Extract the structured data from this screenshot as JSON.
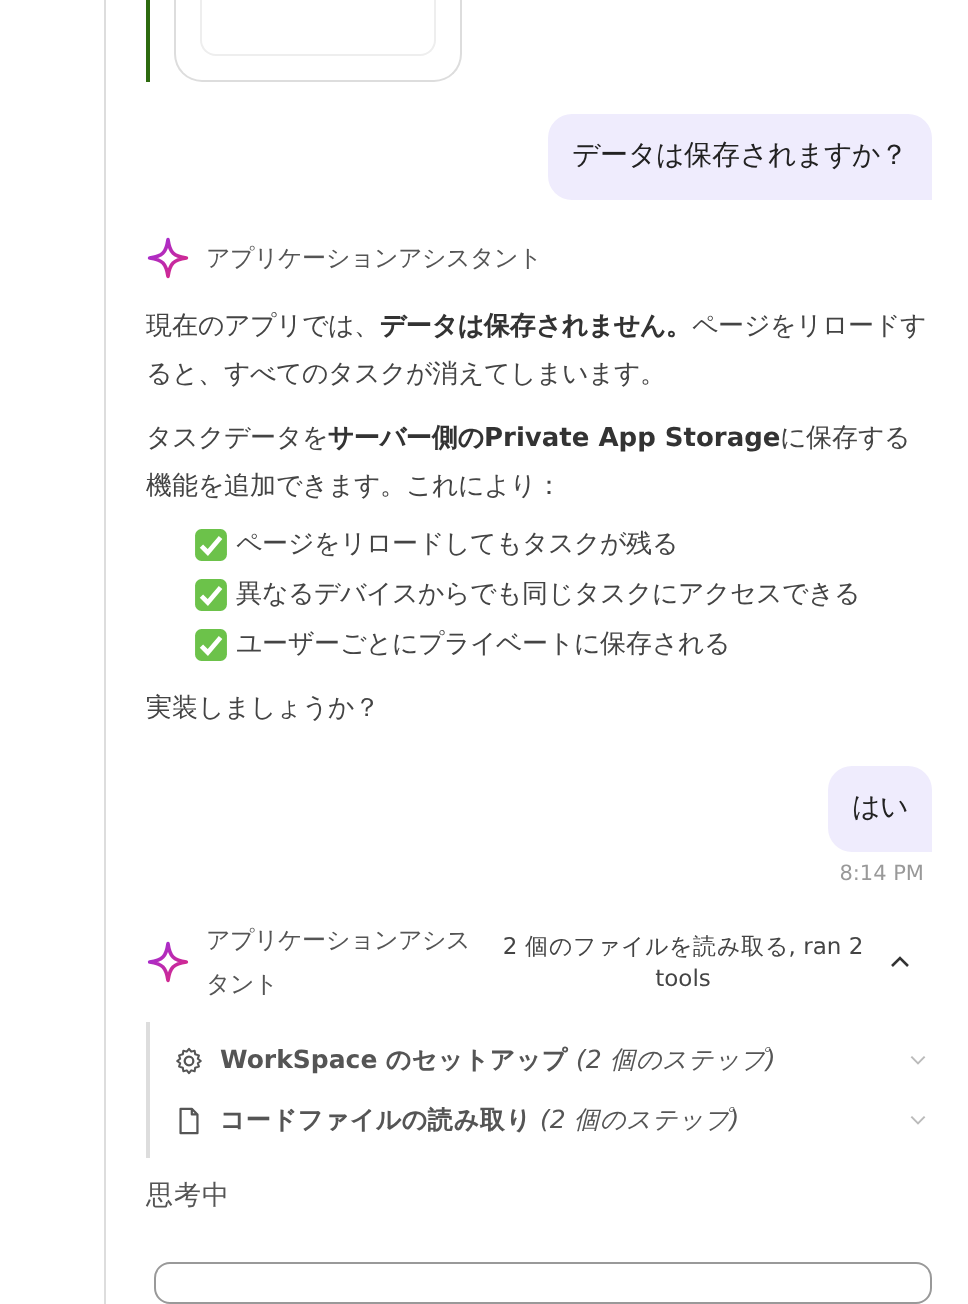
{
  "thread": [
    {
      "kind": "user",
      "text": "データは保存されますか？"
    },
    {
      "kind": "assistant",
      "sender": "アプリケーションアシスタント",
      "paragraphs": [
        "現在のアプリでは、**データは保存されません。**ページをリロードすると、すべてのタスクが消えてしまいます。",
        "タスクデータを**サーバー側のPrivate App Storage**に保存する機能を追加できます。これにより："
      ],
      "checklist": [
        "ページをリロードしてもタスクが残る",
        "異なるデバイスからでも同じタスクにアクセスできる",
        "ユーザーごとにプライベートに保存される"
      ],
      "closing": "実装しましょうか？"
    },
    {
      "kind": "user",
      "text": "はい",
      "time": "8:14 PM"
    },
    {
      "kind": "tools",
      "sender": "アプリケーションアシスタント",
      "summary": "2 個のファイルを読み取る, ran 2 tools",
      "expanded": true,
      "steps": [
        {
          "kind": "setup",
          "title": "WorkSpace のセットアップ",
          "count": "(2 個のステップ)"
        },
        {
          "kind": "file",
          "title": "コードファイルの読み取り",
          "count": "(2 個のステップ)"
        }
      ]
    }
  ],
  "status": "思考中"
}
